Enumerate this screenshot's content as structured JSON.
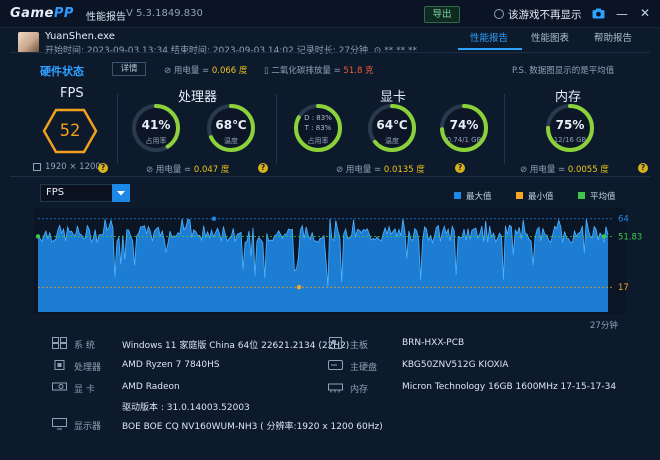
{
  "titlebar": {
    "logo_a": "Game",
    "logo_b": "PP",
    "title": "性能报告",
    "version": "V 5.3.1849.830",
    "export_label": "导出",
    "hide_label": "该游戏不再显示"
  },
  "session": {
    "process": "YuanShen.exe",
    "times": "开始时间: 2023-09-03 13:34   结束时间: 2023-09-03 14:02   记录时长: 27分钟",
    "location": "**.**.**"
  },
  "tabs": [
    "性能报告",
    "性能图表",
    "帮助报告"
  ],
  "hardware": {
    "title": "硬件状态",
    "detail_label": "详情",
    "power_total_label": "用电量 = ",
    "power_total_value": "0.066 度",
    "co2_label": "二氧化碳排放量 = ",
    "co2_value": "51.8 克",
    "note": "P.S. 数据图显示的是平均值"
  },
  "fps": {
    "title": "FPS",
    "value": "52",
    "resolution": "1920 × 1200"
  },
  "cpu": {
    "title": "处理器",
    "usage_value": "41%",
    "usage_label": "占用率",
    "usage_fraction": 0.41,
    "temp_value": "68℃",
    "temp_label": "温度",
    "temp_fraction": 0.68,
    "power_label": "用电量 = ",
    "power_value": "0.047 度"
  },
  "gpu": {
    "title": "显卡",
    "d_label": "D : 83%",
    "t_label": "T : 83%",
    "usage_label": "占用率",
    "usage_fraction": 0.83,
    "temp_value": "64℃",
    "temp_label": "温度",
    "temp_fraction": 0.64,
    "vram_value": "74%",
    "vram_label": "0.74/1 GB",
    "vram_fraction": 0.74,
    "power_label": "用电量 = ",
    "power_value": "0.0135 度"
  },
  "memory": {
    "title": "内存",
    "value": "75%",
    "label": "12/16 GB",
    "fraction": 0.75,
    "power_label": "用电量 = ",
    "power_value": "0.0055 度"
  },
  "chart": {
    "metric": "FPS",
    "legend": [
      {
        "label": "最大值",
        "color": "#1e88e5"
      },
      {
        "label": "最小值",
        "color": "#f5a623"
      },
      {
        "label": "平均值",
        "color": "#3cc94a"
      }
    ],
    "duration_label": "27分钟"
  },
  "chart_data": {
    "type": "area",
    "series": [
      {
        "name": "最大值",
        "value": 64
      },
      {
        "name": "最小值",
        "value": 17
      },
      {
        "name": "平均值",
        "value": 51.83
      }
    ],
    "ylim": [
      0,
      70
    ],
    "x_range_minutes": [
      0,
      27
    ],
    "tick_labels": [
      "64",
      "51.83",
      "17"
    ]
  },
  "system_info": [
    {
      "label": "系 统",
      "value": "Windows 11 家庭版 China 64位 22621.2134 (22H2)"
    },
    {
      "label": "处理器",
      "value": "AMD Ryzen 7 7840HS"
    },
    {
      "label": "显 卡",
      "value": "AMD Radeon"
    },
    {
      "label": "",
      "value": "驱动版本 : 31.0.14003.52003"
    },
    {
      "label": "显示器",
      "value": "BOE BOE CQ NV160WUM-NH3 ( 分辨率:1920 x 1200 60Hz)"
    },
    {
      "label": "主板",
      "value": "BRN-HXX-PCB"
    },
    {
      "label": "主硬盘",
      "value": "KBG50ZNV512G KIOXIA"
    },
    {
      "label": "内存",
      "value": "Micron Technology 16GB 1600MHz 17-15-17-34"
    }
  ]
}
